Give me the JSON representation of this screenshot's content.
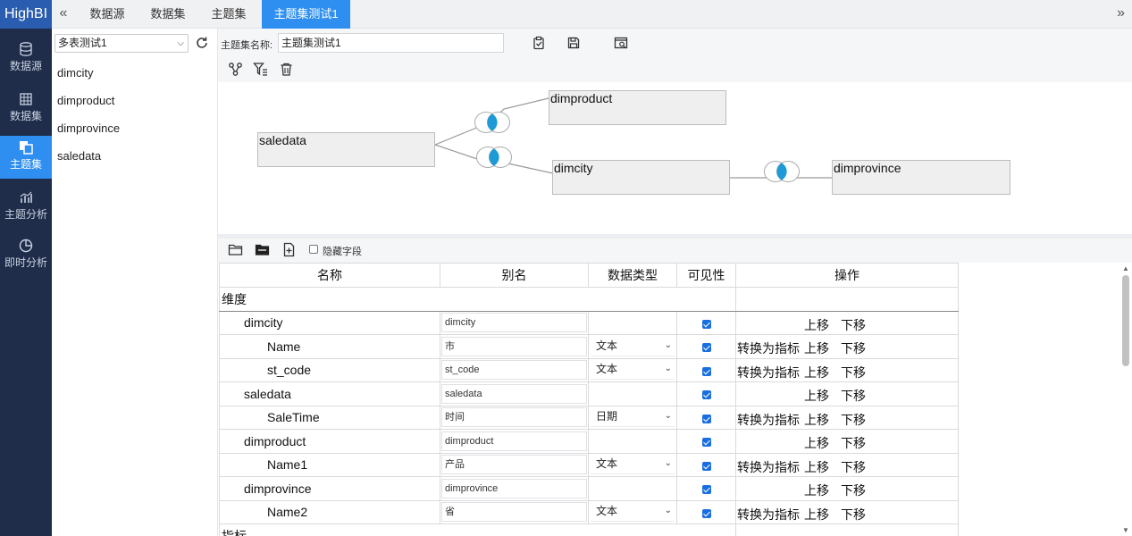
{
  "app": {
    "logo": "HighBI"
  },
  "topbar": {
    "collapse_icon": "«",
    "expand_icon": "»",
    "tabs": [
      {
        "label": "数据源"
      },
      {
        "label": "数据集"
      },
      {
        "label": "主题集"
      },
      {
        "label": "主题集测试1",
        "active": true
      }
    ]
  },
  "nav": {
    "items": [
      {
        "label": "数据源",
        "icon": "database-icon"
      },
      {
        "label": "数据集",
        "icon": "table-icon"
      },
      {
        "label": "主题集",
        "icon": "copy-icon",
        "active": true
      },
      {
        "label": "主题分析",
        "icon": "bar-chart-icon"
      },
      {
        "label": "即时分析",
        "icon": "pie-chart-icon"
      }
    ]
  },
  "list_panel": {
    "selected_set": "多表测试1",
    "items": [
      "dimcity",
      "dimproduct",
      "dimprovince",
      "saledata"
    ]
  },
  "header": {
    "name_label": "主题集名称:",
    "name_value": "主题集测试1"
  },
  "diagram": {
    "nodes": [
      "saledata",
      "dimproduct",
      "dimcity",
      "dimprovince"
    ],
    "joins": [
      {
        "from": "saledata",
        "to": "dimproduct",
        "type": "inner-join"
      },
      {
        "from": "saledata",
        "to": "dimcity",
        "type": "inner-join"
      },
      {
        "from": "dimcity",
        "to": "dimprovince",
        "type": "inner-join"
      }
    ]
  },
  "fields_toolbar": {
    "hide_fields_label": "隐藏字段"
  },
  "grid": {
    "headers": [
      "名称",
      "别名",
      "数据类型",
      "可见性",
      "操作"
    ],
    "section_dimension": "维度",
    "section_measure": "指标",
    "ops": {
      "to_measure": "转换为指标",
      "up": "上移",
      "down": "下移"
    },
    "rows": [
      {
        "name": "dimcity",
        "alias": "dimcity",
        "type": "",
        "visible": true,
        "level": 1,
        "convert": false
      },
      {
        "name": "Name",
        "alias": "市",
        "type": "文本",
        "visible": true,
        "level": 2,
        "convert": true
      },
      {
        "name": "st_code",
        "alias": "st_code",
        "type": "文本",
        "visible": true,
        "level": 2,
        "convert": true
      },
      {
        "name": "saledata",
        "alias": "saledata",
        "type": "",
        "visible": true,
        "level": 1,
        "convert": false
      },
      {
        "name": "SaleTime",
        "alias": "时间",
        "type": "日期",
        "visible": true,
        "level": 2,
        "convert": true
      },
      {
        "name": "dimproduct",
        "alias": "dimproduct",
        "type": "",
        "visible": true,
        "level": 1,
        "convert": false
      },
      {
        "name": "Name1",
        "alias": "产品",
        "type": "文本",
        "visible": true,
        "level": 2,
        "convert": true
      },
      {
        "name": "dimprovince",
        "alias": "dimprovince",
        "type": "",
        "visible": true,
        "level": 1,
        "convert": false
      },
      {
        "name": "Name2",
        "alias": "省",
        "type": "文本",
        "visible": true,
        "level": 2,
        "convert": true
      }
    ]
  }
}
